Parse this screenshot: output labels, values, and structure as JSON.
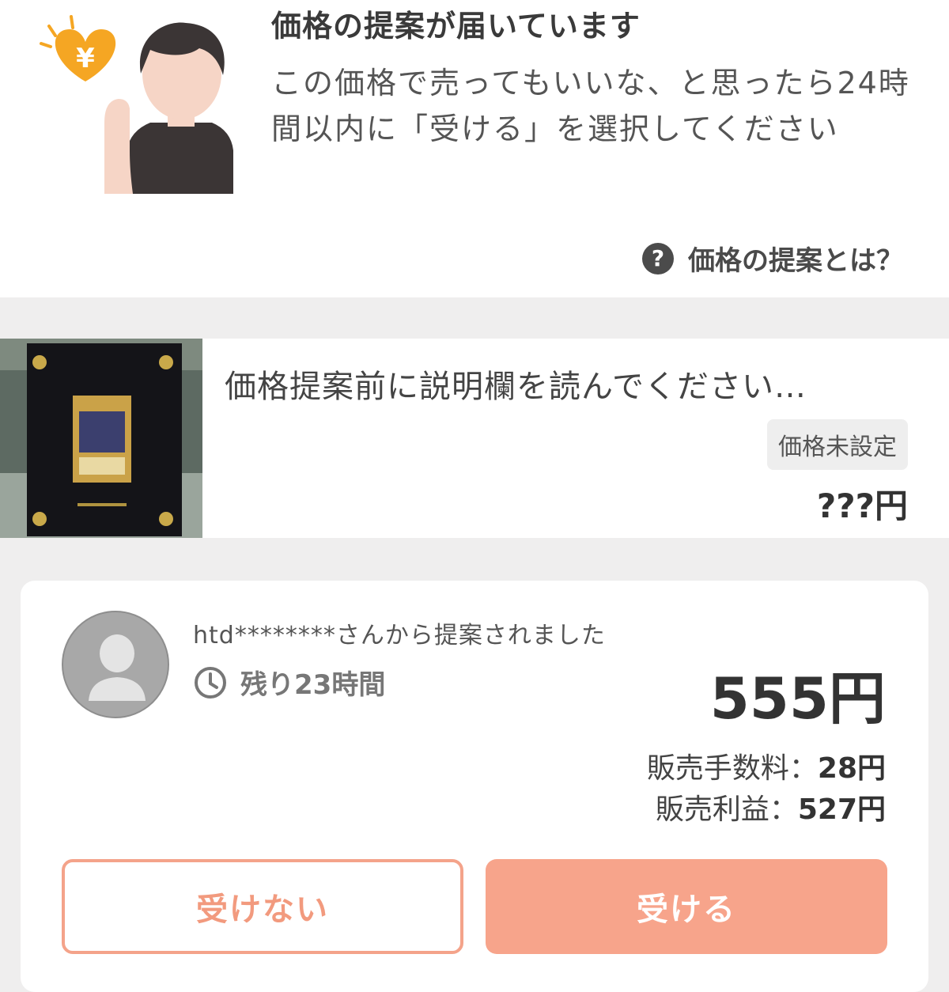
{
  "header": {
    "title": "価格の提案が届いています",
    "description": "この価格で売ってもいいな、と思ったら24時間以内に「受ける」を選択してください",
    "help_link": "価格の提案とは？",
    "help_icon": "question-circle-icon"
  },
  "item": {
    "title": "価格提案前に説明欄を読んでください…",
    "badge": "価格未設定",
    "price": "???円"
  },
  "offer": {
    "from_text": "htd********さんから提案されました",
    "remaining": "残り23時間",
    "price": "555円",
    "fee_label": "販売手数料：",
    "fee_value": "28円",
    "profit_label": "販売利益：",
    "profit_value": "527円"
  },
  "actions": {
    "decline": "受けない",
    "accept": "受ける"
  },
  "colors": {
    "accent": "#f7a48b",
    "accent_text": "#f29a7e",
    "heart": "#f5a623"
  }
}
